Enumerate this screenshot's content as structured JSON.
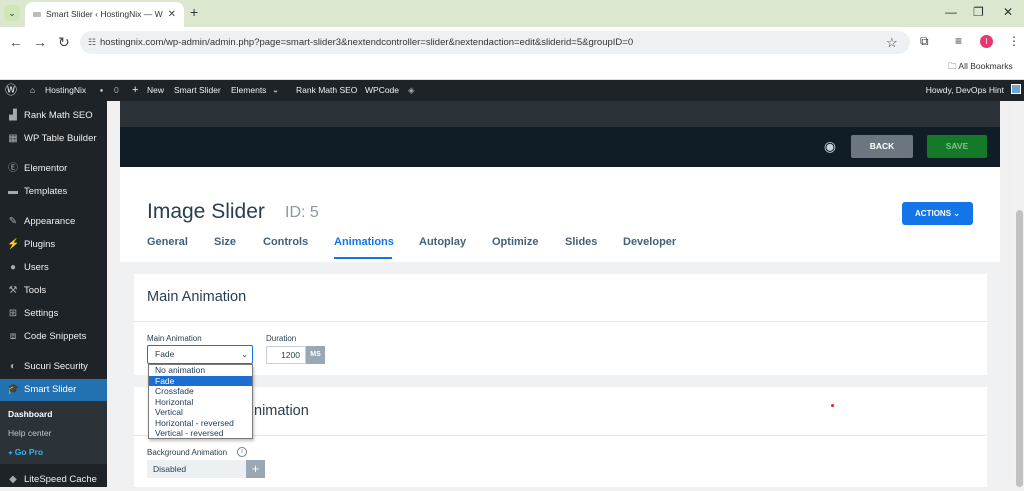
{
  "browser": {
    "tab_title": "Smart Slider ‹ HostingNix — W",
    "url": "hostingnix.com/wp-admin/admin.php?page=smart-slider3&nextendcontroller=slider&nextendaction=edit&sliderid=5&groupID=0",
    "profile_initial": "I",
    "bookmarks_label": "All Bookmarks"
  },
  "adminbar": {
    "site": "HostingNix",
    "comments": "0",
    "new": "New",
    "items": [
      "Smart Slider",
      "Elements",
      "Rank Math SEO",
      "WPCode"
    ],
    "howdy": "Howdy, DevOps Hint"
  },
  "sidebar": {
    "items": [
      {
        "label": "Rank Math SEO",
        "icon": "rank-math-icon"
      },
      {
        "label": "WP Table Builder",
        "icon": "table-icon"
      },
      {
        "label": "Elementor",
        "icon": "elementor-icon"
      },
      {
        "label": "Templates",
        "icon": "folder-icon"
      },
      {
        "label": "Appearance",
        "icon": "brush-icon"
      },
      {
        "label": "Plugins",
        "icon": "plugin-icon"
      },
      {
        "label": "Users",
        "icon": "user-icon"
      },
      {
        "label": "Tools",
        "icon": "wrench-icon"
      },
      {
        "label": "Settings",
        "icon": "settings-icon"
      },
      {
        "label": "Code Snippets",
        "icon": "code-icon"
      },
      {
        "label": "Sucuri Security",
        "icon": "sucuri-icon"
      },
      {
        "label": "Smart Slider",
        "icon": "graduation-cap-icon"
      },
      {
        "label": "LiteSpeed Cache",
        "icon": "litespeed-icon"
      }
    ],
    "submenu": [
      "Dashboard",
      "Help center",
      "Go Pro"
    ]
  },
  "toolbar": {
    "back": "BACK",
    "save": "SAVE"
  },
  "slider": {
    "title": "Image Slider",
    "id": "ID: 5",
    "actions": "ACTIONS"
  },
  "tabs": [
    "General",
    "Size",
    "Controls",
    "Animations",
    "Autoplay",
    "Optimize",
    "Slides",
    "Developer"
  ],
  "selected_tab": "Animations",
  "main_animation": {
    "heading": "Main Animation",
    "field_label": "Main Animation",
    "value": "Fade",
    "duration_label": "Duration",
    "duration": "1200",
    "unit": "MS",
    "options": [
      "No animation",
      "Fade",
      "Crossfade",
      "Horizontal",
      "Vertical",
      "Horizontal - reversed",
      "Vertical - reversed"
    ],
    "highlighted": "Fade"
  },
  "background_animation": {
    "heading_visible": "nimation",
    "field_label": "Background Animation",
    "value": "Disabled"
  },
  "colors": {
    "accent": "#1375e8",
    "save": "#147a29",
    "wp_dark": "#1d2327",
    "wp_blue": "#2271b1"
  }
}
